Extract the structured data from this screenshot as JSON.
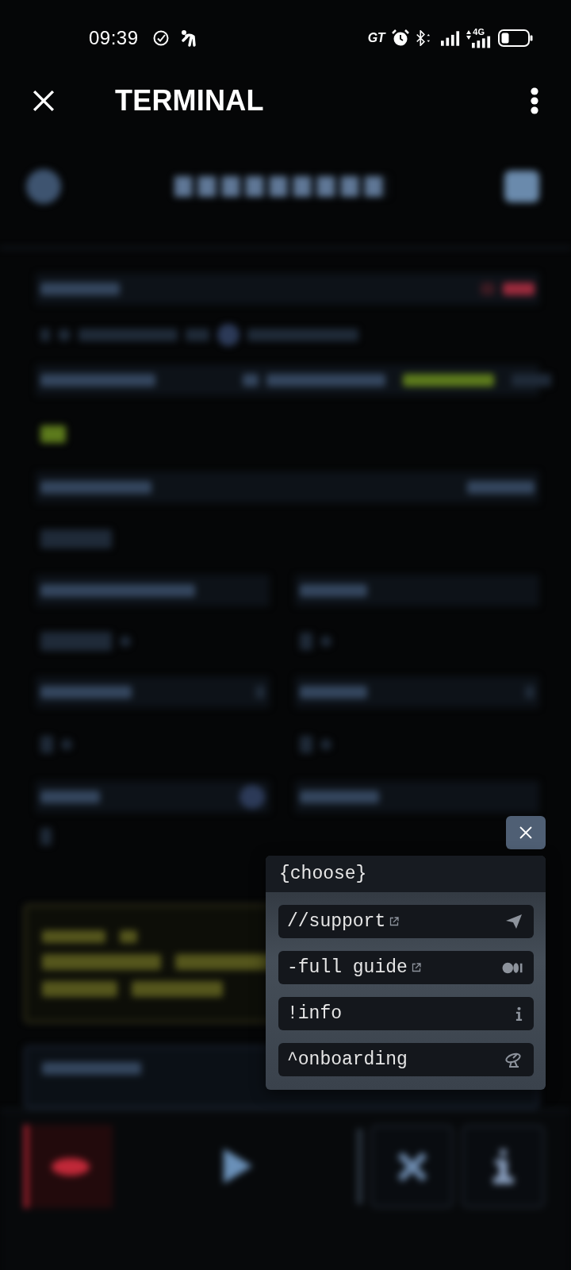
{
  "status_bar": {
    "time": "09:39",
    "mode_label": "GT",
    "network": "4G"
  },
  "app_bar": {
    "title": "TERMINAL"
  },
  "menu": {
    "title": "{choose}",
    "items": [
      {
        "label": "//support",
        "external": true
      },
      {
        "label": "-full guide",
        "external": true
      },
      {
        "label": "!info",
        "external": false
      },
      {
        "label": "^onboarding",
        "external": false
      }
    ]
  }
}
